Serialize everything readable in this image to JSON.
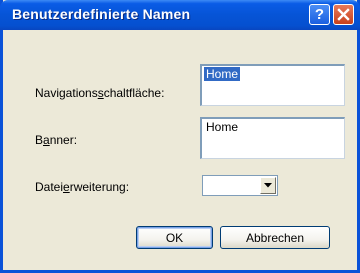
{
  "window": {
    "title": "Benutzerdefinierte Namen",
    "help_glyph": "?"
  },
  "fields": {
    "nav_label_pre": "Navigations",
    "nav_label_accel": "s",
    "nav_label_post": "chaltfläche:",
    "nav_value": "Home",
    "banner_label_pre": "B",
    "banner_label_accel": "a",
    "banner_label_post": "nner:",
    "banner_value": "Home",
    "ext_label_pre": "Datei",
    "ext_label_accel": "e",
    "ext_label_post": "rweiterung:",
    "ext_value": ""
  },
  "buttons": {
    "ok_label": "OK",
    "cancel_label": "Abbrechen"
  },
  "colors": {
    "titlebar": "#0654d6",
    "close_button": "#c8401c",
    "selection": "#316ac5",
    "dialog_face": "#ece9d8"
  }
}
